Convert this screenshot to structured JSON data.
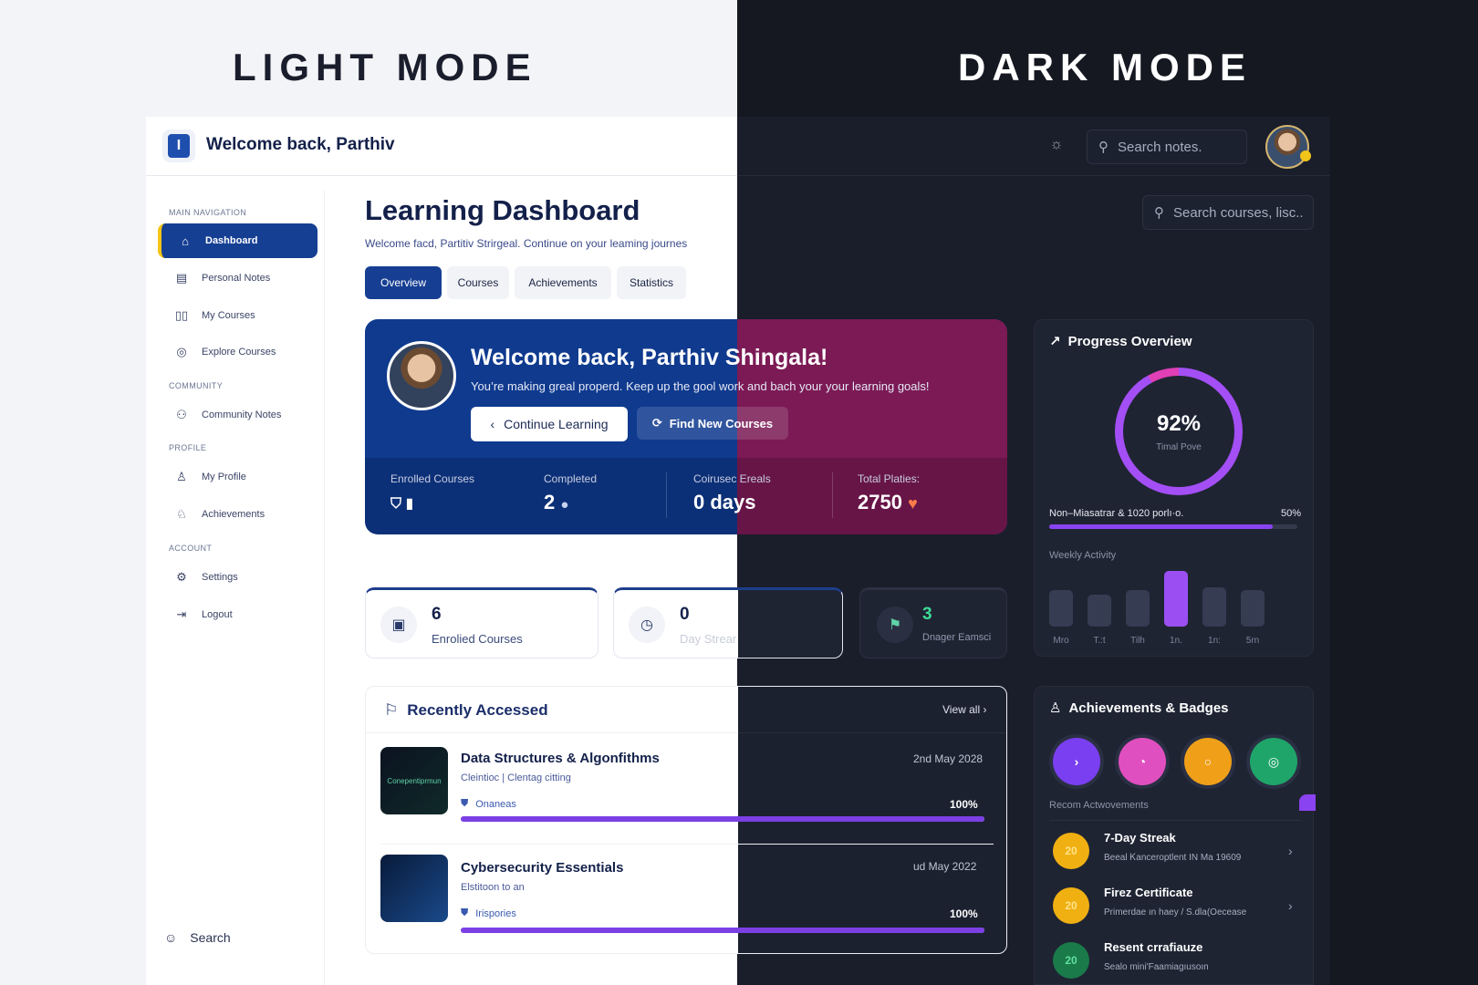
{
  "modes": {
    "light": "LIGHT MODE",
    "dark": "DARK MODE"
  },
  "topbar": {
    "welcome": "Welcome back, Parthiv",
    "logo_letter": "I",
    "search_placeholder": "Search notes."
  },
  "sidebar": {
    "sections": {
      "main": "MAIN NAVIGATION",
      "community": "COMMUNITY",
      "profile": "PROFILE",
      "account": "ACCOUNT"
    },
    "items": [
      {
        "label": "Dashboard",
        "icon": "home-icon",
        "active": true
      },
      {
        "label": "Personal Notes",
        "icon": "document-icon"
      },
      {
        "label": "My Courses",
        "icon": "book-icon"
      },
      {
        "label": "Explore Courses",
        "icon": "compass-icon"
      },
      {
        "label": "Community Notes",
        "icon": "users-icon"
      },
      {
        "label": "My Profile",
        "icon": "user-icon"
      },
      {
        "label": "Achievements",
        "icon": "award-icon"
      },
      {
        "label": "Settings",
        "icon": "gear-icon"
      },
      {
        "label": "Logout",
        "icon": "logout-icon"
      }
    ],
    "bottom_search": "Search"
  },
  "main": {
    "title": "Learning Dashboard",
    "subtitle": "Welcome facd,  Partitiv Strirgeal. Continue on your leaming journes",
    "tabs": [
      "Overview",
      "Courses",
      "Achievements",
      "Statistics"
    ],
    "search_courses_placeholder": "Search courses, lisc.."
  },
  "hero": {
    "title": "Welcome back, Parthiv Shingala!",
    "subtitle": "You’re making greal properd. Keep up the gool work and bach your your learning goals!",
    "continue_btn": "Continue Learning",
    "find_btn": "Find New Courses",
    "stats": [
      {
        "label": "Enrolled Courses",
        "value": ""
      },
      {
        "label": "Completed",
        "value": "2"
      },
      {
        "label": "Coirusec Ereals",
        "value": "0 days"
      },
      {
        "label": "Total Platies:",
        "value": "2750"
      }
    ]
  },
  "mini_cards": [
    {
      "num": "6",
      "label": "Enrolied Courses"
    },
    {
      "num": "0",
      "label": "Day Strear"
    },
    {
      "num": "3",
      "label": "Dnager Eamsci"
    }
  ],
  "recent": {
    "title": "Recently Accessed",
    "view_all": "View all",
    "courses": [
      {
        "title": "Data Structures & Algonfithms",
        "sub": "Cleintioc  |  Clentag citting",
        "tag": "Onaneas",
        "date": "2nd May 2028",
        "pct": "100%",
        "progress": 1.0,
        "thumb": "Conepentiprmun"
      },
      {
        "title": "Cybersecurity Essentials",
        "sub": "Elstitoon to an",
        "tag": "Irispories",
        "date": "ud May 2022",
        "pct": "100%",
        "progress": 1.0,
        "thumb": ""
      }
    ]
  },
  "progress": {
    "title": "Progress Overview",
    "ring_pct": "92%",
    "ring_label": "Timal Pove",
    "line_label": "Non–Miasatrar & 1020 porlı·o.",
    "line_pct": "50%",
    "line_progress": 0.9,
    "weekly_label": "Weekly Activity",
    "days": [
      "Mro",
      "T.:t",
      "Tilh",
      "1n.",
      "1n:",
      "5rn"
    ],
    "activity": [
      0.55,
      0.48,
      0.55,
      0.85,
      0.6,
      0.55
    ],
    "hot_index": 3
  },
  "achievements": {
    "title": "Achievements & Badges",
    "badges": [
      {
        "glyph": "›",
        "color": "#7a3ff0"
      },
      {
        "glyph": "◔",
        "color": "#e04fc0"
      },
      {
        "glyph": "○",
        "color": "#f0a018"
      },
      {
        "glyph": "◎",
        "color": "#1fa56a"
      }
    ],
    "recent_label": "Recom Actwovements",
    "items": [
      {
        "title": "7-Day Streak",
        "sub": "Beeal Ꮶanceroptlent IN Ma 19609",
        "icon_text": "20",
        "color": "#f0b012"
      },
      {
        "title": "Firez Certificate",
        "sub": "Primerdae ın haey  /  S.dla(Oecease",
        "icon_text": "20",
        "color": "#f0b012"
      },
      {
        "title": "Resent crrafiauze",
        "sub": "Sealo mini'Faamiagıusoın",
        "icon_text": "20",
        "color": "#1a7a4a"
      }
    ]
  },
  "colors": {
    "primary": "#153f93",
    "accent": "#8a43f0",
    "magenta": "#7b1a55",
    "dark_bg": "#151821"
  }
}
